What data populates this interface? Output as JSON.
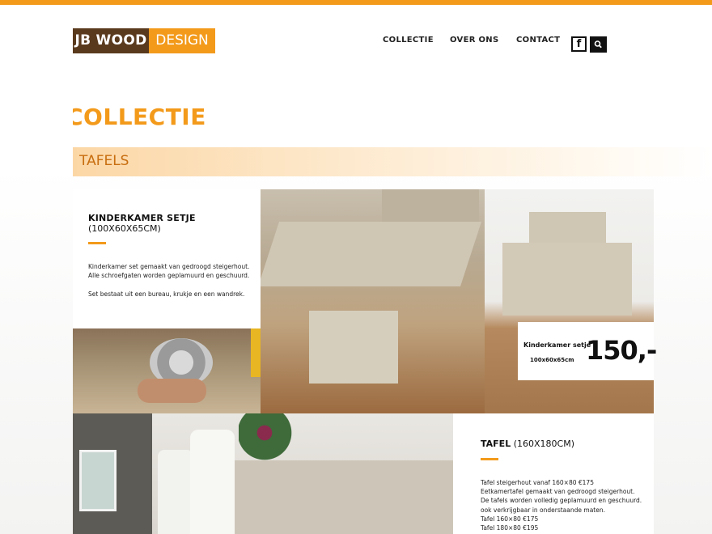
{
  "header": {
    "logo_left": "JB WOOD",
    "logo_right": "DESIGN",
    "nav": [
      "COLLECTIE",
      "OVER ONS",
      "CONTACT"
    ],
    "facebook_icon": "facebook-icon",
    "search_icon": "search-icon"
  },
  "page": {
    "title": "COLLECTIE",
    "section": "TAFELS"
  },
  "product1": {
    "title": "KINDERKAMER SETJE",
    "subtitle": "(100X60X65CM)",
    "line1": "Kinderkamer set gemaakt van gedroogd steigerhout.",
    "line2": "Alle schroefgaten worden geplamuurd en geschuurd.",
    "line3": "Set bestaat uit een bureau, krukje en een wandrek."
  },
  "price_card": {
    "name": "Kinderkamer setje",
    "size": "100x60x65cm",
    "price": "150,-"
  },
  "product2": {
    "title_bold": "TAFEL",
    "title_rest": " (160X180CM)",
    "lines": [
      "Tafel steigerhout vanaf 160×80 €175",
      "Eetkamertafel gemaakt van gedroogd steigerhout.",
      "De tafels worden volledig geplamuurd en geschuurd.",
      "ook verkrijgbaar in onderstaande maten.",
      "Tafel 160×80 €175",
      "Tafel 180×80 €195"
    ]
  },
  "colors": {
    "accent": "#f39a1b",
    "logo_dark": "#5a3a1d"
  }
}
